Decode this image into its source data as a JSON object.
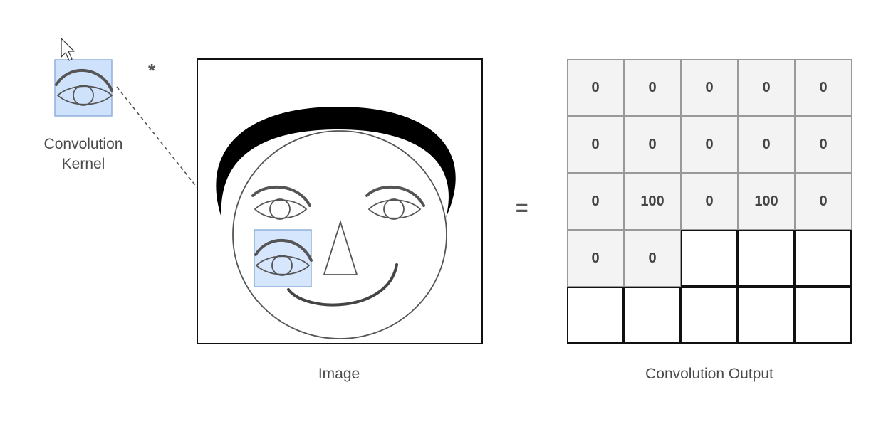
{
  "labels": {
    "kernel": "Convolution\nKernel",
    "image": "Image",
    "output": "Convolution Output",
    "operator_convolve": "*",
    "operator_equals": "="
  },
  "colors": {
    "kernel_highlight": "#cfe2fb",
    "kernel_border": "#8fb0dc",
    "cell_filled": "#f3f3f3",
    "grid_line": "#111111",
    "hair": "#000000"
  },
  "output_grid": {
    "rows": 5,
    "cols": 5,
    "values": [
      [
        "0",
        "0",
        "0",
        "0",
        "0"
      ],
      [
        "0",
        "0",
        "0",
        "0",
        "0"
      ],
      [
        "0",
        "100",
        "0",
        "100",
        "0"
      ],
      [
        "0",
        "0",
        null,
        null,
        null
      ],
      [
        null,
        null,
        null,
        null,
        null
      ]
    ]
  },
  "icons": {
    "cursor": "mouse-pointer-icon"
  }
}
